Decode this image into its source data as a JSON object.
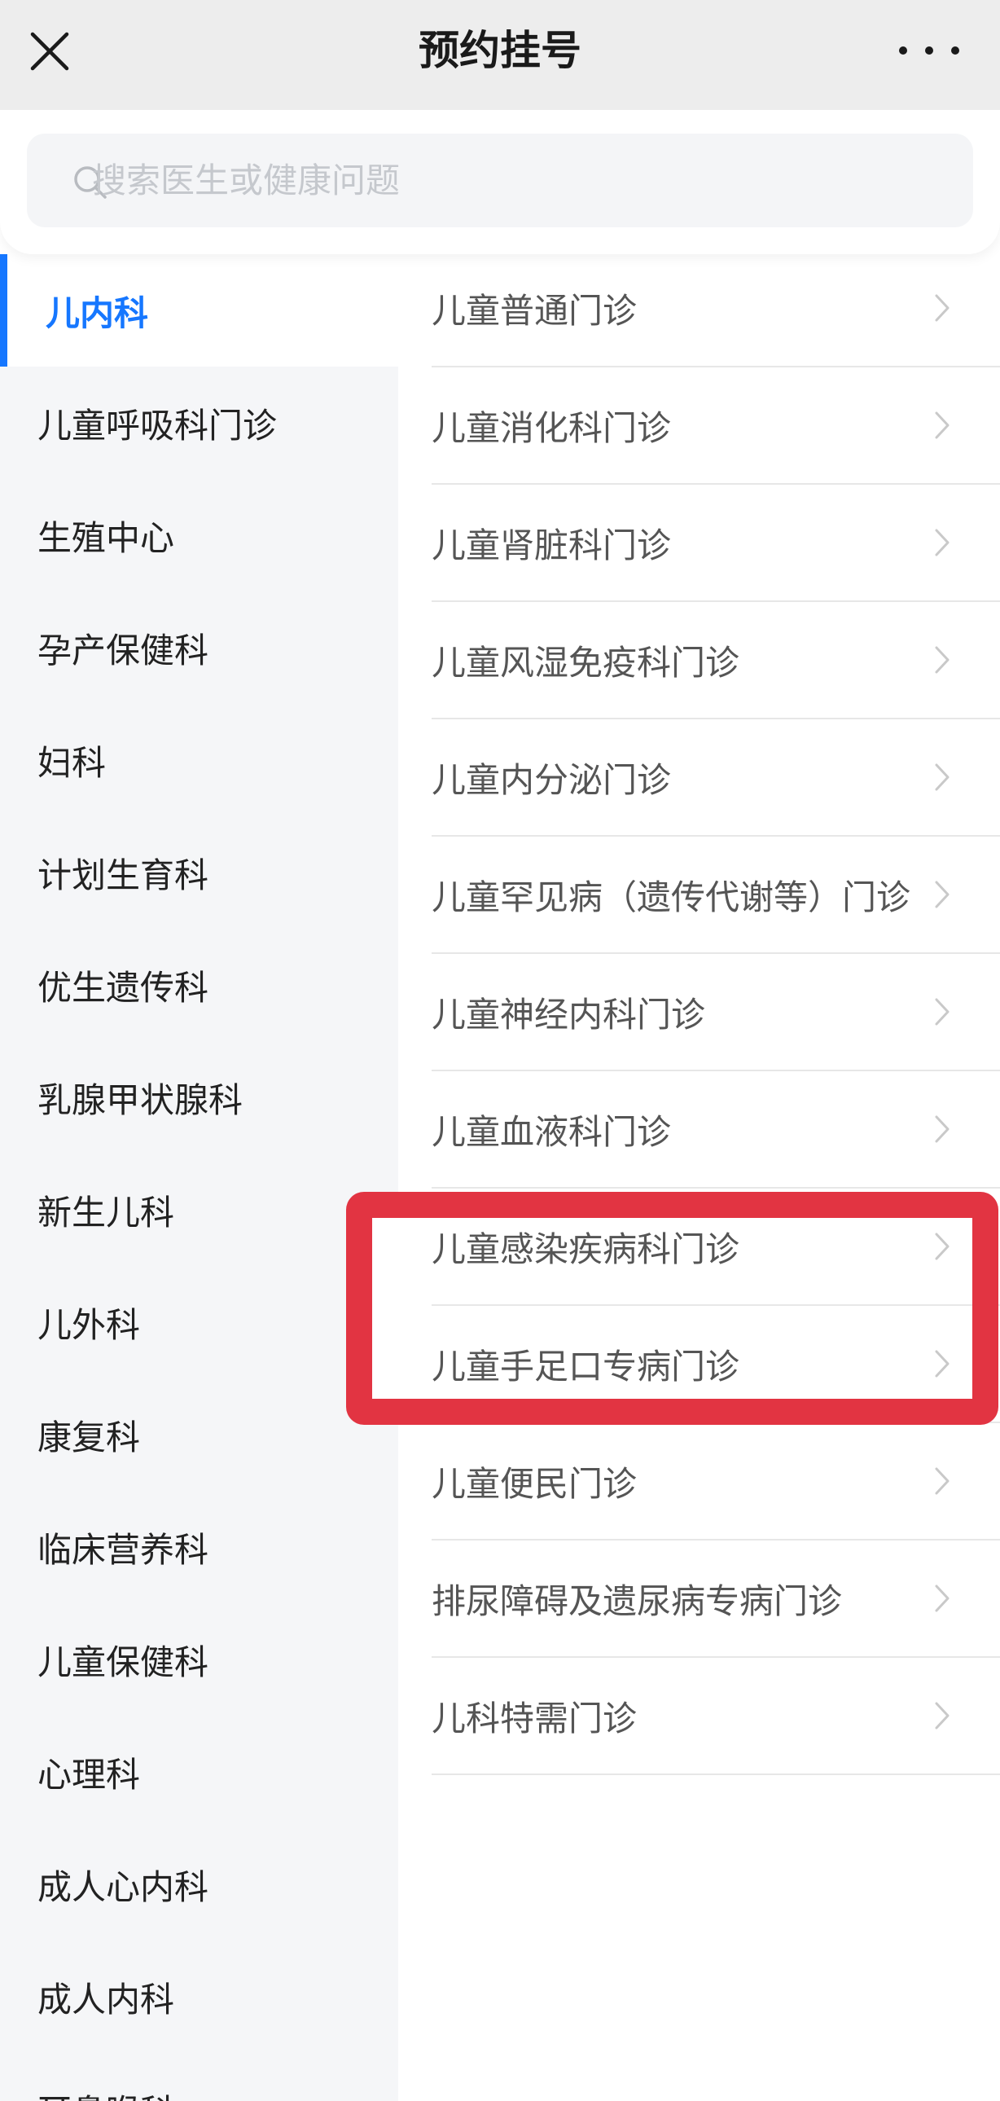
{
  "header": {
    "title": "预约挂号",
    "close_icon": "close-icon",
    "more_icon": "more-horizontal-icon"
  },
  "search": {
    "placeholder": "搜索医生或健康问题",
    "value": "",
    "icon": "search-icon"
  },
  "sidebar": {
    "selected_index": 0,
    "items": [
      {
        "label": "儿内科",
        "selected": true
      },
      {
        "label": "儿童呼吸科门诊"
      },
      {
        "label": "生殖中心"
      },
      {
        "label": "孕产保健科"
      },
      {
        "label": "妇科"
      },
      {
        "label": "计划生育科"
      },
      {
        "label": "优生遗传科"
      },
      {
        "label": "乳腺甲状腺科"
      },
      {
        "label": "新生儿科"
      },
      {
        "label": "儿外科"
      },
      {
        "label": "康复科"
      },
      {
        "label": "临床营养科"
      },
      {
        "label": "儿童保健科"
      },
      {
        "label": "心理科"
      },
      {
        "label": "成人心内科"
      },
      {
        "label": "成人内科"
      },
      {
        "label": "耳鼻喉科"
      }
    ]
  },
  "departments": {
    "row_icon": "chevron-right-icon",
    "items": [
      {
        "label": "儿童普通门诊"
      },
      {
        "label": "儿童消化科门诊"
      },
      {
        "label": "儿童肾脏科门诊"
      },
      {
        "label": "儿童风湿免疫科门诊"
      },
      {
        "label": "儿童内分泌门诊"
      },
      {
        "label": "儿童罕见病（遗传代谢等）门诊"
      },
      {
        "label": "儿童神经内科门诊"
      },
      {
        "label": "儿童血液科门诊"
      },
      {
        "label": "儿童感染疾病科门诊",
        "highlighted": true
      },
      {
        "label": "儿童手足口专病门诊",
        "highlighted": true
      },
      {
        "label": "儿童便民门诊"
      },
      {
        "label": "排尿障碍及遗尿病专病门诊"
      },
      {
        "label": "儿科特需门诊"
      }
    ]
  },
  "colors": {
    "accent": "#1677ff",
    "highlight": "#e23442",
    "header_bg": "#ededed",
    "sidebar_bg": "#f5f6f8",
    "search_bg": "#f4f5f7",
    "divider": "#e7e7e7"
  }
}
